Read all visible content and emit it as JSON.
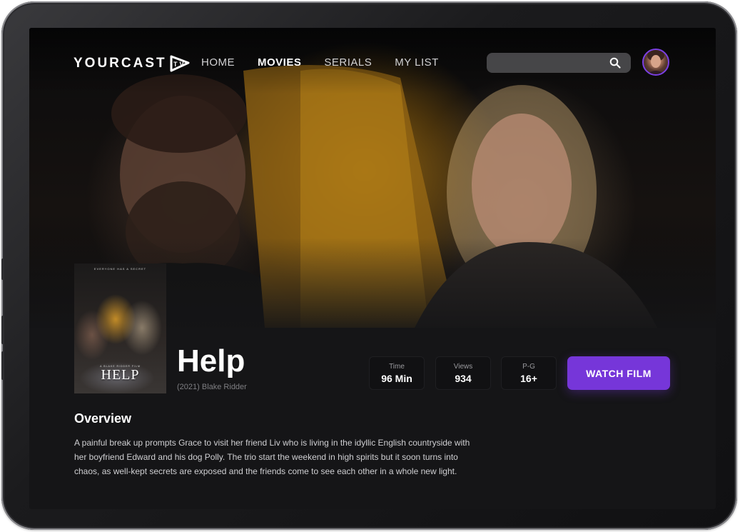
{
  "brand": {
    "name": "YOURCAST",
    "mark": "TV"
  },
  "nav": {
    "items": [
      {
        "label": "HOME",
        "active": false
      },
      {
        "label": "MOVIES",
        "active": true
      },
      {
        "label": "SERIALS",
        "active": false
      },
      {
        "label": "MY LIST",
        "active": false
      }
    ]
  },
  "search": {
    "placeholder": "",
    "icon": "search-icon"
  },
  "profile": {
    "icon": "avatar"
  },
  "poster": {
    "tagline": "EVERYONE HAS A SECRET",
    "subtitle": "A BLAKE RIDDER FILM",
    "title": "HELP"
  },
  "movie": {
    "title": "Help",
    "meta": "(2021) Blake Ridder",
    "stats": [
      {
        "label": "Time",
        "value": "96 Min"
      },
      {
        "label": "Views",
        "value": "934"
      },
      {
        "label": "P-G",
        "value": "16+"
      }
    ],
    "watch_label": "WATCH FILM"
  },
  "overview": {
    "heading": "Overview",
    "text": "A painful break up prompts Grace to visit her friend Liv who is living in the idyllic English countryside with her boyfriend Edward and his dog Polly. The trio start the weekend in high spirits but it soon turns into chaos, as well-kept secrets are exposed and the friends come to see each other in a whole new light."
  },
  "colors": {
    "accent": "#7636d9",
    "background": "#151517",
    "text": "#ffffff",
    "muted": "#7e7e82"
  }
}
